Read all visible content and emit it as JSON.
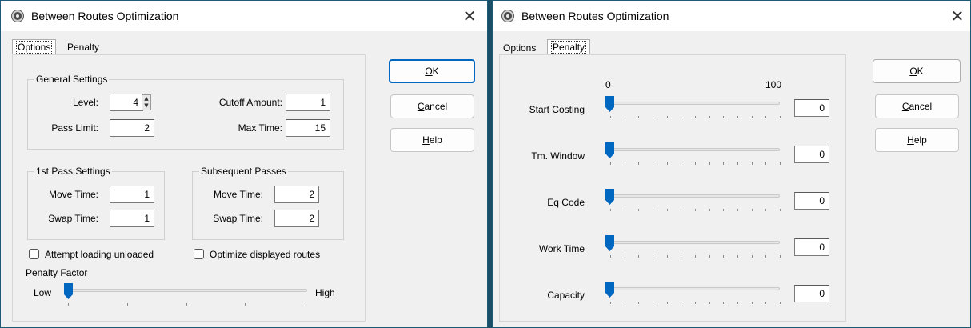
{
  "dialogs": [
    {
      "title": "Between Routes Optimization",
      "tabs": [
        {
          "label": "Options",
          "active": true
        },
        {
          "label": "Penalty",
          "active": false
        }
      ],
      "general_settings": {
        "title": "General Settings",
        "level_label": "Level:",
        "level_value": "4",
        "cutoff_label": "Cutoff Amount:",
        "cutoff_value": "1",
        "pass_limit_label": "Pass Limit:",
        "pass_limit_value": "2",
        "max_time_label": "Max Time:",
        "max_time_value": "15"
      },
      "first_pass": {
        "title": "1st Pass Settings",
        "move_label": "Move Time:",
        "move_value": "1",
        "swap_label": "Swap Time:",
        "swap_value": "1"
      },
      "subsequent": {
        "title": "Subsequent Passes",
        "move_label": "Move Time:",
        "move_value": "2",
        "swap_label": "Swap Time:",
        "swap_value": "2"
      },
      "attempt_loading": {
        "label": "Attempt loading unloaded",
        "checked": false
      },
      "optimize_displayed": {
        "label": "Optimize displayed routes",
        "checked": false
      },
      "penalty_factor": {
        "title": "Penalty Factor",
        "low": "Low",
        "high": "High",
        "value": 0
      },
      "buttons": {
        "ok_u": "O",
        "ok_rest": "K",
        "cancel_u": "C",
        "cancel_rest": "ancel",
        "help_u": "H",
        "help_rest": "elp"
      },
      "close_icon": "close-icon"
    },
    {
      "title": "Between Routes Optimization",
      "tabs": [
        {
          "label": "Options",
          "active": false
        },
        {
          "label": "Penalty",
          "active": true
        }
      ],
      "scale_min": "0",
      "scale_max": "100",
      "sliders": [
        {
          "label": "Start Costing",
          "value": "0"
        },
        {
          "label": "Tm. Window",
          "value": "0"
        },
        {
          "label": "Eq Code",
          "value": "0"
        },
        {
          "label": "Work Time",
          "value": "0"
        },
        {
          "label": "Capacity",
          "value": "0"
        }
      ],
      "buttons": {
        "ok_u": "O",
        "ok_rest": "K",
        "cancel_u": "C",
        "cancel_rest": "ancel",
        "help_u": "H",
        "help_rest": "elp"
      },
      "close_icon": "close-icon"
    }
  ],
  "colors": {
    "titlebar_bg": "#ffffff",
    "dialog_bg": "#f0f0f0",
    "accent": "#0067c0",
    "desktop": "#1b4f66"
  }
}
